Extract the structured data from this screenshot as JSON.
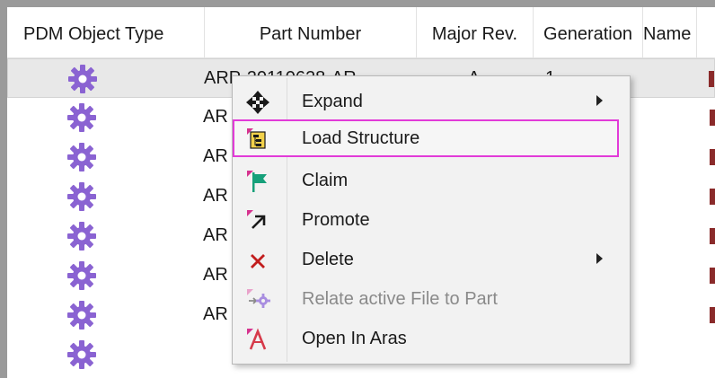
{
  "columns": [
    "PDM Object Type",
    "Part Number",
    "Major Rev.",
    "Generation",
    "Name"
  ],
  "rows": [
    {
      "icon": "gear-icon",
      "part": "ARP-20110628-AR",
      "rev": "A",
      "gen": "1"
    },
    {
      "icon": "gear-icon",
      "part": "AR",
      "rev": "",
      "gen": ""
    },
    {
      "icon": "gear-icon",
      "part": "AR",
      "rev": "",
      "gen": ""
    },
    {
      "icon": "gear-icon",
      "part": "AR",
      "rev": "",
      "gen": ""
    },
    {
      "icon": "gear-icon",
      "part": "AR",
      "rev": "",
      "gen": ""
    },
    {
      "icon": "gear-icon",
      "part": "AR",
      "rev": "",
      "gen": ""
    },
    {
      "icon": "gear-icon",
      "part": "AR",
      "rev": "",
      "gen": ""
    }
  ],
  "menu": [
    {
      "label": "Expand",
      "icon": "expand-arrows-icon",
      "submenu": true
    },
    {
      "label": "Load Structure",
      "icon": "load-structure-icon",
      "highlighted": true
    },
    {
      "label": "Claim",
      "icon": "claim-flag-icon"
    },
    {
      "label": "Promote",
      "icon": "promote-arrow-icon"
    },
    {
      "label": "Delete",
      "icon": "delete-x-icon",
      "submenu": true
    },
    {
      "label": "Relate active File to Part",
      "icon": "relate-file-icon",
      "disabled": true
    },
    {
      "label": "Open In Aras",
      "icon": "aras-logo-icon"
    }
  ],
  "colors": {
    "gear": "#8a63d2",
    "highlight_border": "#e23bd8",
    "edge_mark": "#8a2a2a"
  }
}
